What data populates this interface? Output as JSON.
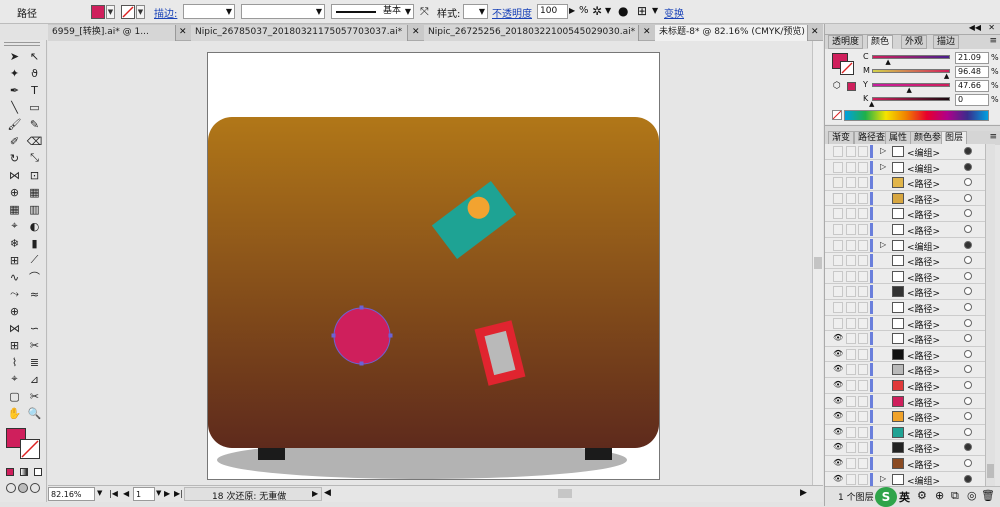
{
  "control_bar": {
    "object_type": "路径",
    "stroke_label": "描边:",
    "stroke_value": "",
    "stroke_style_label": "基本",
    "style_label": "样式:",
    "opacity_label": "不透明度",
    "opacity_value": "100",
    "opacity_unit": "%",
    "transform_label": "变换",
    "fill_color": "#cf1f5c"
  },
  "doc_tabs": [
    {
      "label": "6959_[转换].ai* @ 1..."
    },
    {
      "label": "Nipic_26785037_20180321175057703037.ai*"
    },
    {
      "label": "Nipic_26725256_20180322100545029030.ai*"
    },
    {
      "label": "未标题-8* @ 82.16% (CMYK/预览)"
    }
  ],
  "status_bar": {
    "zoom": "82.16%",
    "page": "1",
    "history": "18 次还原: 无重做"
  },
  "color_panel": {
    "tabs": [
      {
        "label": "透明度"
      },
      {
        "label": "颜色"
      },
      {
        "label": "外观"
      },
      {
        "label": "描边"
      }
    ],
    "channels": [
      {
        "name": "C",
        "value": "21.09",
        "level": 0.21
      },
      {
        "name": "M",
        "value": "96.48",
        "level": 0.96
      },
      {
        "name": "Y",
        "value": "47.66",
        "level": 0.48
      },
      {
        "name": "K",
        "value": "0",
        "level": 0
      }
    ]
  },
  "layers_panel": {
    "tabs": [
      {
        "label": "渐变"
      },
      {
        "label": "路径查"
      },
      {
        "label": "属性"
      },
      {
        "label": "颜色参"
      },
      {
        "label": "图层"
      }
    ],
    "rows": [
      {
        "label": "<编组>",
        "visible": false,
        "group": true,
        "thumb": "#ffffff",
        "target_filled": true
      },
      {
        "label": "<编组>",
        "visible": false,
        "group": true,
        "thumb": "#ffffff",
        "target_filled": true
      },
      {
        "label": "<路径>",
        "visible": false,
        "group": false,
        "thumb": "#e1b54a",
        "target_filled": false
      },
      {
        "label": "<路径>",
        "visible": false,
        "group": false,
        "thumb": "#d7a640",
        "target_filled": false
      },
      {
        "label": "<路径>",
        "visible": false,
        "group": false,
        "thumb": "#ffffff",
        "target_filled": false
      },
      {
        "label": "<路径>",
        "visible": false,
        "group": false,
        "thumb": "#ffffff",
        "target_filled": false
      },
      {
        "label": "<编组>",
        "visible": false,
        "group": true,
        "thumb": "#ffffff",
        "target_filled": true
      },
      {
        "label": "<路径>",
        "visible": false,
        "group": false,
        "thumb": "#ffffff",
        "target_filled": false
      },
      {
        "label": "<路径>",
        "visible": false,
        "group": false,
        "thumb": "#ffffff",
        "target_filled": false
      },
      {
        "label": "<路径>",
        "visible": false,
        "group": false,
        "thumb": "#333333",
        "target_filled": false
      },
      {
        "label": "<路径>",
        "visible": false,
        "group": false,
        "thumb": "#ffffff",
        "target_filled": false
      },
      {
        "label": "<路径>",
        "visible": false,
        "group": false,
        "thumb": "#ffffff",
        "target_filled": false
      },
      {
        "label": "<路径>",
        "visible": true,
        "group": false,
        "thumb": "#ffffff",
        "target_filled": false
      },
      {
        "label": "<路径>",
        "visible": true,
        "group": false,
        "thumb": "#111111",
        "target_filled": false
      },
      {
        "label": "<路径>",
        "visible": true,
        "group": false,
        "thumb": "#b9b9b9",
        "target_filled": false
      },
      {
        "label": "<路径>",
        "visible": true,
        "group": false,
        "thumb": "#e03a3a",
        "target_filled": false
      },
      {
        "label": "<路径>",
        "visible": true,
        "group": false,
        "thumb": "#cf1f5c",
        "target_filled": false
      },
      {
        "label": "<路径>",
        "visible": true,
        "group": false,
        "thumb": "#f0a22a",
        "target_filled": false
      },
      {
        "label": "<路径>",
        "visible": true,
        "group": false,
        "thumb": "#20a394",
        "target_filled": false
      },
      {
        "label": "<路径>",
        "visible": true,
        "group": false,
        "thumb": "#222222",
        "target_filled": true
      },
      {
        "label": "<路径>",
        "visible": true,
        "group": false,
        "thumb": "#8a4a22",
        "target_filled": false
      },
      {
        "label": "<编组>",
        "visible": true,
        "group": true,
        "thumb": "#ffffff",
        "target_filled": true
      }
    ],
    "footer": "1 个图层"
  },
  "artwork": {
    "bag_gradient_top": "#b17718",
    "bag_gradient_bottom": "#5e2a1c",
    "tag_color": "#1ea394",
    "tag_dot_color": "#f2a330",
    "circle_color": "#cf1f5c",
    "sticker_outer": "#e0242f",
    "sticker_inner": "#b9b9b9",
    "shadow_color": "#b3b3b3",
    "feet_color": "#1b1b1b"
  },
  "ime": {
    "label": "英"
  }
}
